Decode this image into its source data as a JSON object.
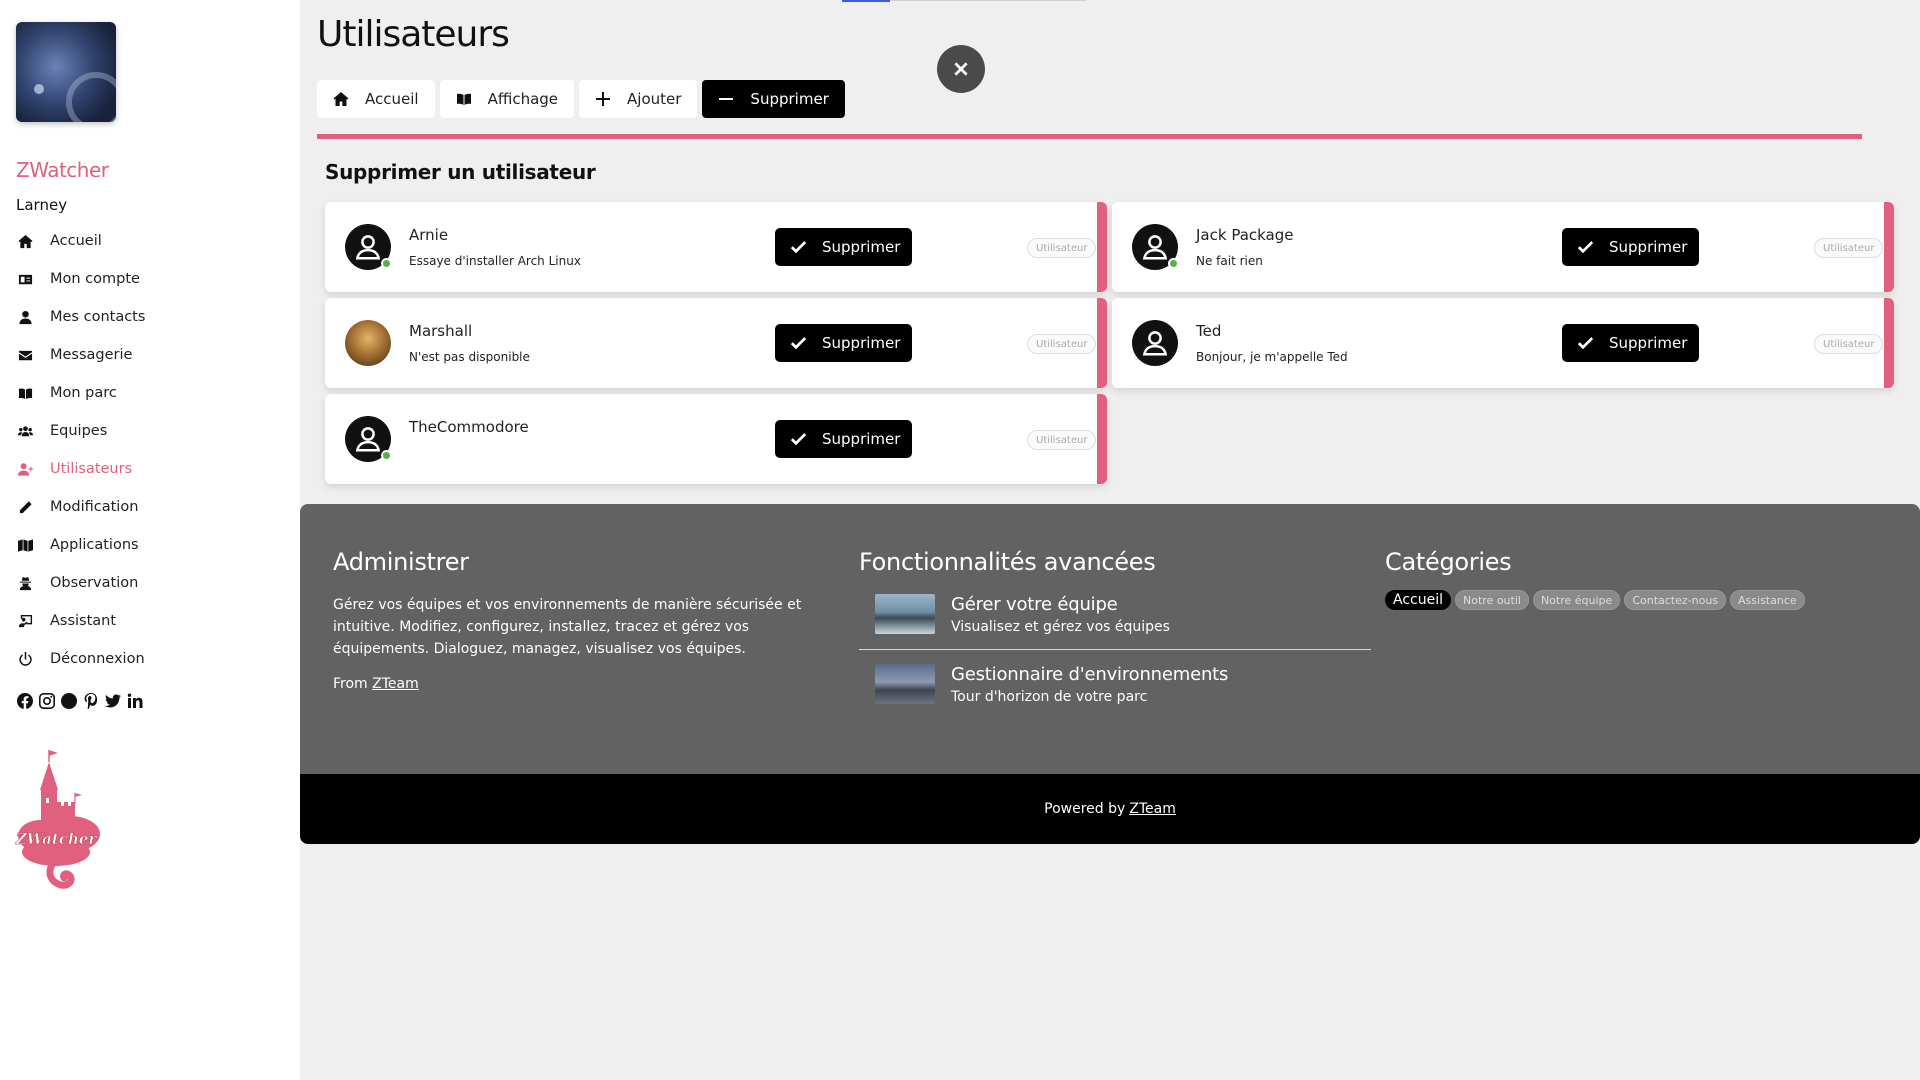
{
  "sidebar": {
    "brand": "ZWatcher",
    "username": "Larney",
    "items": [
      {
        "label": "Accueil",
        "icon": "home-icon"
      },
      {
        "label": "Mon compte",
        "icon": "id-card-icon"
      },
      {
        "label": "Mes contacts",
        "icon": "user-icon"
      },
      {
        "label": "Messagerie",
        "icon": "envelope-icon"
      },
      {
        "label": "Mon parc",
        "icon": "book-open-icon"
      },
      {
        "label": "Equipes",
        "icon": "users-icon"
      },
      {
        "label": "Utilisateurs",
        "icon": "user-plus-icon",
        "active": true
      },
      {
        "label": "Modification",
        "icon": "pencil-icon"
      },
      {
        "label": "Applications",
        "icon": "map-icon"
      },
      {
        "label": "Observation",
        "icon": "user-secret-icon"
      },
      {
        "label": "Assistant",
        "icon": "chalkboard-icon"
      },
      {
        "label": "Déconnexion",
        "icon": "power-icon"
      }
    ],
    "socials": [
      "facebook-icon",
      "instagram-icon",
      "snapchat-icon",
      "pinterest-icon",
      "twitter-icon",
      "linkedin-icon"
    ],
    "logo_text": "ZWatcher"
  },
  "header": {
    "title": "Utilisateurs",
    "tabs": [
      {
        "label": "Accueil",
        "icon": "home-icon"
      },
      {
        "label": "Affichage",
        "icon": "book-open-icon"
      },
      {
        "label": "Ajouter",
        "icon": "plus-icon"
      },
      {
        "label": "Supprimer",
        "icon": "minus-icon",
        "active": true
      }
    ]
  },
  "section": {
    "title": "Supprimer un utilisateur",
    "delete_label": "Supprimer",
    "users": [
      {
        "name": "Arnie",
        "status": "Essaye d'installer Arch Linux",
        "role": "Utilisateur",
        "online": true
      },
      {
        "name": "Jack Package",
        "status": "Ne fait rien",
        "role": "Utilisateur",
        "online": true
      },
      {
        "name": "Marshall",
        "status": "N'est pas disponible",
        "role": "Utilisateur",
        "online": false,
        "photo": true
      },
      {
        "name": "Ted",
        "status": "Bonjour, je m'appelle Ted",
        "role": "Utilisateur",
        "online": false
      },
      {
        "name": "TheCommodore",
        "status": "",
        "role": "Utilisateur",
        "online": true
      }
    ]
  },
  "footer": {
    "admin": {
      "title": "Administrer",
      "text": "Gérez vos équipes et vos environnements de manière sécurisée et intuitive. Modifiez, configurez, installez, tracez et gérez vos équipements. Dialoguez, managez, visualisez vos équipes.",
      "from_label": "From",
      "from_link": "ZTeam"
    },
    "features": {
      "title": "Fonctionnalités avancées",
      "items": [
        {
          "title": "Gérer votre équipe",
          "desc": "Visualisez et gérez vos équipes"
        },
        {
          "title": "Gestionnaire d'environnements",
          "desc": "Tour d'horizon de votre parc"
        }
      ]
    },
    "categories": {
      "title": "Catégories",
      "chips": [
        {
          "label": "Accueil",
          "active": true
        },
        {
          "label": "Notre outil"
        },
        {
          "label": "Notre équipe"
        },
        {
          "label": "Contactez-nous"
        },
        {
          "label": "Assistance"
        }
      ]
    },
    "powered_label": "Powered by",
    "powered_link": "ZTeam"
  },
  "colors": {
    "accent": "#e0607e",
    "dark": "#000000",
    "footer": "#626262",
    "online": "#55b04b"
  }
}
